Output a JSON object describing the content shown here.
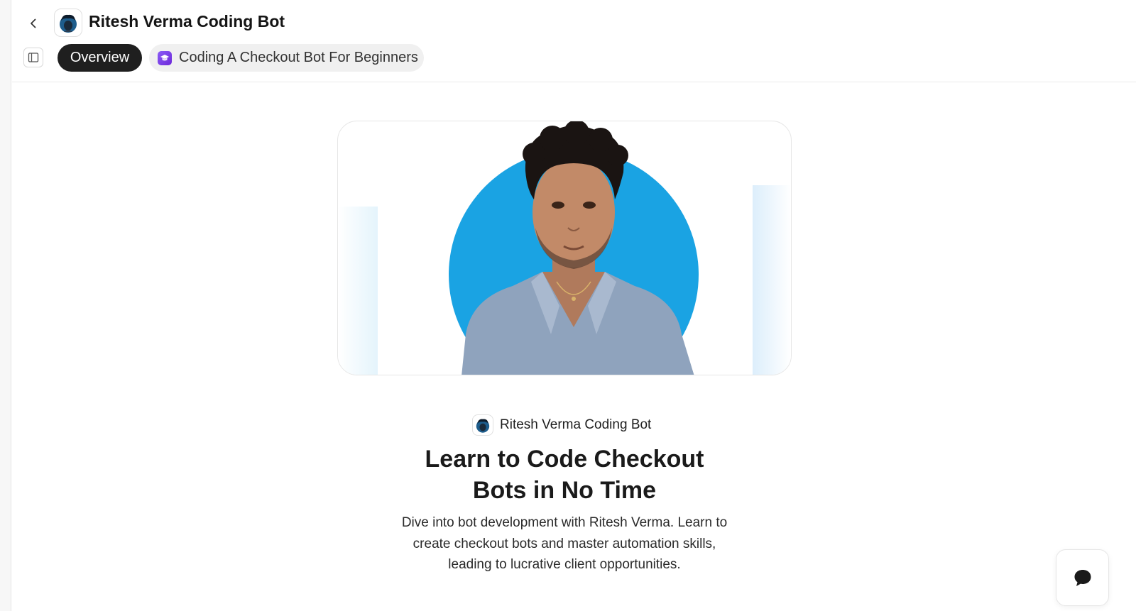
{
  "app": {
    "bot_name": "Ritesh Verma Coding Bot"
  },
  "tabs": [
    {
      "label": "Overview",
      "selected": true
    },
    {
      "label": "Coding A Checkout Bot For Beginners",
      "selected": false,
      "icon": "graduation-cap-icon"
    }
  ],
  "intro": {
    "byline": "Ritesh Verma Coding Bot",
    "title": "Learn to Code Checkout Bots in No Time",
    "description": "Dive into bot development with Ritesh Verma. Learn to create checkout bots and master automation skills, leading to lucrative client opportunities."
  },
  "icons": {
    "back": "chevron-left-icon",
    "sidebar_toggle": "sidebar-panel-icon",
    "chat": "chat-bubble-icon"
  },
  "colors": {
    "accent_circle": "#1aa3e3",
    "active_tab_bg": "#1f1f1f",
    "course_icon": "#7c4ddb"
  }
}
